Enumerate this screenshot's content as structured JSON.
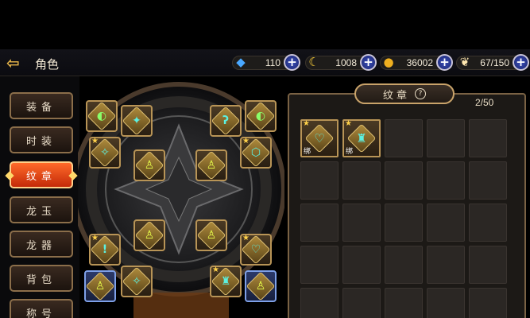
{
  "header": {
    "back_icon": "back-arrow-icon",
    "title": "角色"
  },
  "resources": [
    {
      "name": "diamond",
      "icon": "diamond-icon",
      "value": "110",
      "color": "#4aa8ff"
    },
    {
      "name": "crescent",
      "icon": "crescent-icon",
      "value": "1008",
      "color": "#ffd23a"
    },
    {
      "name": "gold",
      "icon": "gold-coin-icon",
      "value": "36002",
      "color": "#f0b020"
    },
    {
      "name": "stamina",
      "icon": "wing-icon",
      "value": "67/150",
      "color": "#ffe7b0"
    }
  ],
  "tabs": [
    {
      "label": "装备",
      "active": false
    },
    {
      "label": "时装",
      "active": false
    },
    {
      "label": "纹章",
      "active": true
    },
    {
      "label": "龙玉",
      "active": false
    },
    {
      "label": "龙器",
      "active": false
    },
    {
      "label": "背包",
      "active": false
    },
    {
      "label": "称号",
      "active": false
    }
  ],
  "emblem_panel": {
    "title": "纹章",
    "help_icon": "?",
    "count": "2/50"
  },
  "inventory": [
    {
      "icon": "heart-emblem-icon",
      "bind_label": "绑",
      "starred": true
    },
    {
      "icon": "warrior-emblem-icon",
      "bind_label": "绑",
      "starred": true
    }
  ],
  "wheel_slots": [
    {
      "icon": "moon-emblem-icon",
      "glyph": "◐",
      "color": "#8aff6a",
      "style": "gold",
      "star": false
    },
    {
      "icon": "shield-emblem-icon",
      "glyph": "✦",
      "color": "#5cf0e0",
      "style": "gold",
      "star": false
    },
    {
      "icon": "swirl-emblem-icon",
      "glyph": "ʔ",
      "color": "#5cf0e0",
      "style": "gold",
      "star": false
    },
    {
      "icon": "moon-emblem-icon",
      "glyph": "◐",
      "color": "#8aff6a",
      "style": "gold",
      "star": false
    },
    {
      "icon": "runner-emblem-icon",
      "glyph": "✧",
      "color": "#5cf0e0",
      "style": "gold",
      "star": true
    },
    {
      "icon": "flame-emblem-icon",
      "glyph": "♙",
      "color": "#e8ff4a",
      "style": "gold",
      "star": false
    },
    {
      "icon": "flame-emblem-icon",
      "glyph": "♙",
      "color": "#e8ff4a",
      "style": "gold",
      "star": false
    },
    {
      "icon": "shield-emblem-icon",
      "glyph": "⬡",
      "color": "#5cf0e0",
      "style": "gold",
      "star": true
    },
    {
      "icon": "flame-emblem-icon",
      "glyph": "♙",
      "color": "#e8ff4a",
      "style": "gold",
      "star": false
    },
    {
      "icon": "flame-emblem-icon",
      "glyph": "♙",
      "color": "#e8ff4a",
      "style": "gold",
      "star": false
    },
    {
      "icon": "exclaim-emblem-icon",
      "glyph": "!",
      "color": "#5cf0e0",
      "style": "gold",
      "star": true
    },
    {
      "icon": "heart-emblem-icon",
      "glyph": "♡",
      "color": "#5cf0e0",
      "style": "gold",
      "star": true
    },
    {
      "icon": "flame-emblem-icon",
      "glyph": "♙",
      "color": "#e8ff4a",
      "style": "blue",
      "star": false
    },
    {
      "icon": "runner-emblem-icon",
      "glyph": "✧",
      "color": "#5cf0e0",
      "style": "gold",
      "star": false
    },
    {
      "icon": "warrior-emblem-icon",
      "glyph": "♜",
      "color": "#5cf0e0",
      "style": "gold",
      "star": true
    },
    {
      "icon": "flame-emblem-icon",
      "glyph": "♙",
      "color": "#e8ff4a",
      "style": "blue",
      "star": false
    }
  ]
}
